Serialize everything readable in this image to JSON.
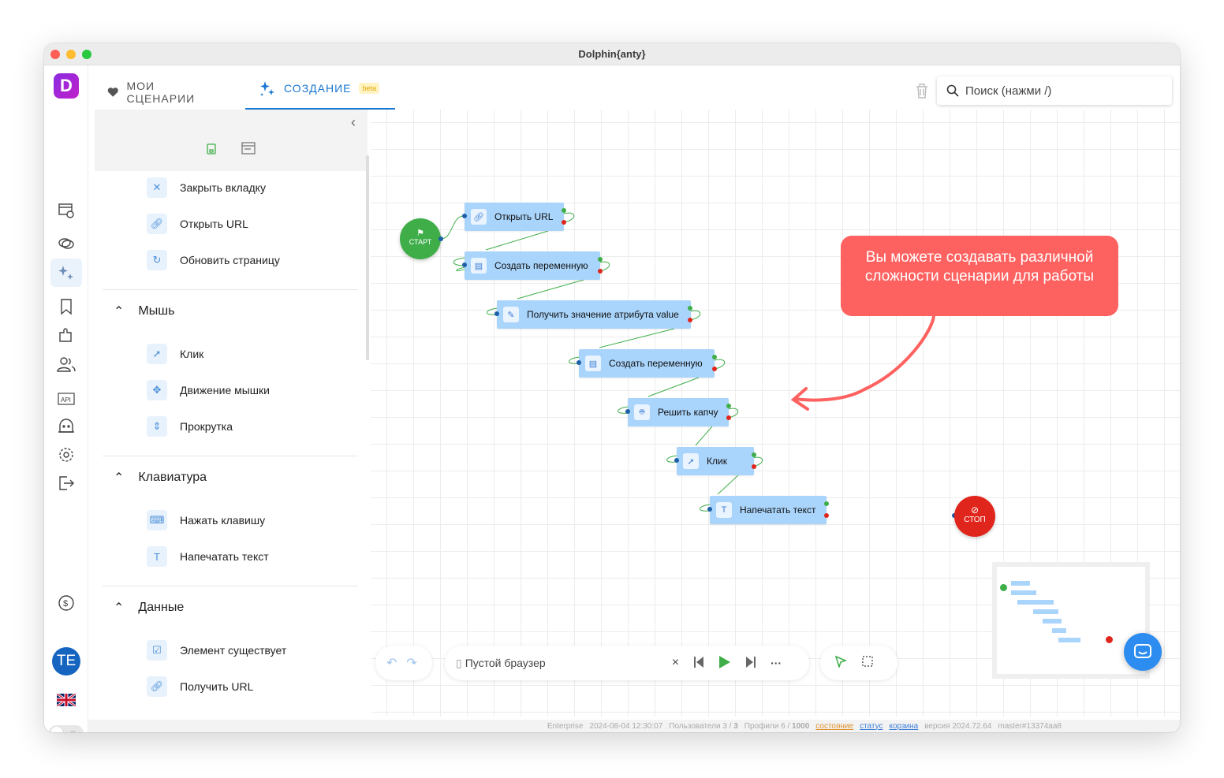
{
  "window": {
    "title": "Dolphin{anty}"
  },
  "rail": {
    "logo": "D",
    "avatar": "TE"
  },
  "tabs": {
    "my_scenarios": "МОИ СЦЕНАРИИ",
    "create": "СОЗДАНИЕ",
    "beta": "beta"
  },
  "search": {
    "placeholder": "Поиск (нажми /)"
  },
  "panel": {
    "top_items": [
      {
        "label": "Закрыть вкладку",
        "icon": "close-icon"
      },
      {
        "label": "Открыть URL",
        "icon": "link-icon"
      },
      {
        "label": "Обновить страницу",
        "icon": "refresh-icon"
      }
    ],
    "sections": [
      {
        "title": "Мышь",
        "items": [
          {
            "label": "Клик",
            "icon": "cursor-click-icon"
          },
          {
            "label": "Движение мышки",
            "icon": "move-icon"
          },
          {
            "label": "Прокрутка",
            "icon": "scroll-icon"
          }
        ]
      },
      {
        "title": "Клавиатура",
        "items": [
          {
            "label": "Нажать клавишу",
            "icon": "keyboard-icon"
          },
          {
            "label": "Напечатать текст",
            "icon": "text-icon"
          }
        ]
      },
      {
        "title": "Данные",
        "items": [
          {
            "label": "Элемент существует",
            "icon": "checkbox-icon"
          },
          {
            "label": "Получить URL",
            "icon": "link-icon"
          }
        ]
      }
    ]
  },
  "canvas": {
    "start": "СТАРТ",
    "stop": "СТОП",
    "nodes": [
      "Открыть URL",
      "Создать переменную",
      "Получить значение атрибута value",
      "Создать переменную",
      "Решить капчу",
      "Клик",
      "Напечатать текст"
    ],
    "callout": "Вы можете создавать различной сложности сценарии для работы"
  },
  "controls": {
    "browser": "Пустой браузер"
  },
  "status": {
    "plan": "Enterprise",
    "datetime": "2024-08-04 12:30:07",
    "users_label": "Пользователи 3 /",
    "users_max": "3",
    "profiles_label": "Профили 6 /",
    "profiles_max": "1000",
    "state_link": "состояние",
    "status_link": "статус",
    "cart_link": "корзина",
    "version": "версия 2024.72.64",
    "build": "master#13374aa8"
  },
  "colors": {
    "accent": "#1976d2",
    "node": "#a9d4fb",
    "start": "#3fae49",
    "stop": "#e0261c",
    "callout": "#fe6260"
  }
}
